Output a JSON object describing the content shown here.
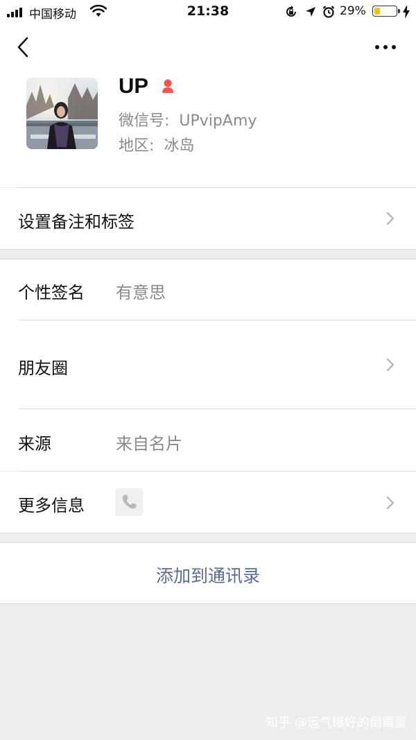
{
  "status_bar": {
    "carrier": "中国移动",
    "time": "21:38",
    "battery_percent": "29%",
    "battery_level": 0.29,
    "icons": [
      "signal-icon",
      "wifi-icon",
      "orientation-lock-icon",
      "location-icon",
      "alarm-icon",
      "battery-icon",
      "charging-icon"
    ]
  },
  "nav": {
    "back_icon": "chevron-left-icon",
    "more_icon": "more-dots-icon"
  },
  "profile": {
    "name": "UP",
    "gender_icon": "female-icon",
    "gender_color": "#fa5151",
    "wechat_id_label": "微信号:",
    "wechat_id": "UPvipAmy",
    "region_label": "地区:",
    "region": "冰岛"
  },
  "rows": {
    "remark_tags": {
      "title": "设置备注和标签"
    },
    "signature": {
      "title": "个性签名",
      "value": "有意思"
    },
    "moments": {
      "title": "朋友圈"
    },
    "source": {
      "title": "来源",
      "value": "来自名片"
    },
    "more_info": {
      "title": "更多信息",
      "icon": "phone-icon"
    }
  },
  "actions": {
    "add_contact_label": "添加到通讯录",
    "link_color": "#576b95"
  },
  "watermark": "知乎 @运气爆好的倒霉蛋"
}
